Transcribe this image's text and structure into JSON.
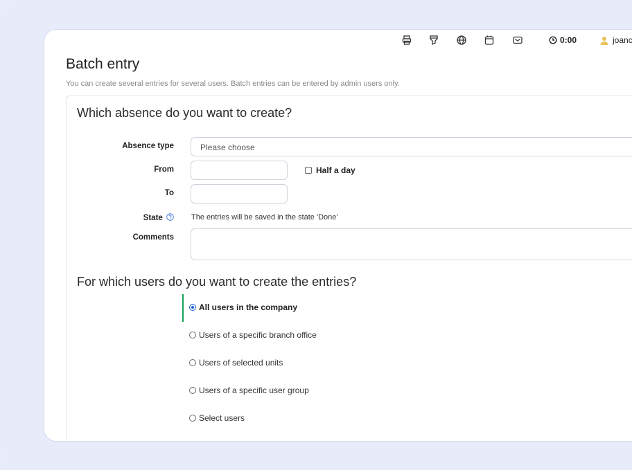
{
  "toolbar": {
    "icons": [
      "printer-icon",
      "filter-icon",
      "globe-icon",
      "calendar-icon",
      "mail-icon"
    ],
    "timer": "0:00",
    "user_name": "joanc"
  },
  "page": {
    "title": "Batch entry",
    "description": "You can create several entries for several users. Batch entries can be entered by admin users only."
  },
  "absence_section": {
    "title": "Which absence do you want to create?",
    "absence_type_label": "Absence type",
    "absence_type_value": "Please choose",
    "from_label": "From",
    "to_label": "To",
    "half_day_label": "Half a day",
    "state_label": "State",
    "state_text": "The entries will be saved in the state 'Done'",
    "comments_label": "Comments"
  },
  "users_section": {
    "title": "For which users do you want to create the entries?",
    "options": [
      {
        "label": "All users in the company",
        "selected": true
      },
      {
        "label": "Users of a specific branch office",
        "selected": false
      },
      {
        "label": "Users of selected units",
        "selected": false
      },
      {
        "label": "Users of a specific user group",
        "selected": false
      },
      {
        "label": "Select users",
        "selected": false
      }
    ]
  },
  "colors": {
    "accent_bar": "#17a35a",
    "radio_selected": "#1a5cd8",
    "backdrop": "#e8ebfa"
  }
}
